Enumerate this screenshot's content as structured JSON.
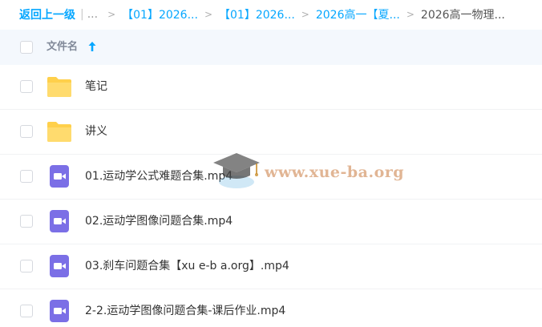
{
  "breadcrumb": {
    "back_label": "返回上一级",
    "pipe": "|",
    "more": "...",
    "separator": ">",
    "items": [
      {
        "label": "【01】2026..."
      },
      {
        "label": "【01】2026..."
      },
      {
        "label": "2026高一【夏..."
      }
    ],
    "current": "2026高一物理..."
  },
  "table_header": {
    "label": "文件名",
    "sort_icon": "arrow-up-icon"
  },
  "files": [
    {
      "name": "笔记",
      "icon": "folder-icon"
    },
    {
      "name": "讲义",
      "icon": "folder-icon"
    },
    {
      "name": "01.运动学公式难题合集.mp4",
      "icon": "video-file-icon"
    },
    {
      "name": "02.运动学图像问题合集.mp4",
      "icon": "video-file-icon"
    },
    {
      "name": "03.刹车问题合集【xu e-b a.org】.mp4",
      "icon": "video-file-icon"
    },
    {
      "name": "2-2.运动学图像问题合集-课后作业.mp4",
      "icon": "video-file-icon"
    }
  ],
  "watermark": {
    "text": "www.xue-ba.org",
    "icon": "graduation-cap-logo"
  },
  "colors": {
    "accent": "#06a7ff",
    "folder": "#ffd04b",
    "video": "#7b6fe6",
    "header_bg": "#f4f8fd"
  }
}
